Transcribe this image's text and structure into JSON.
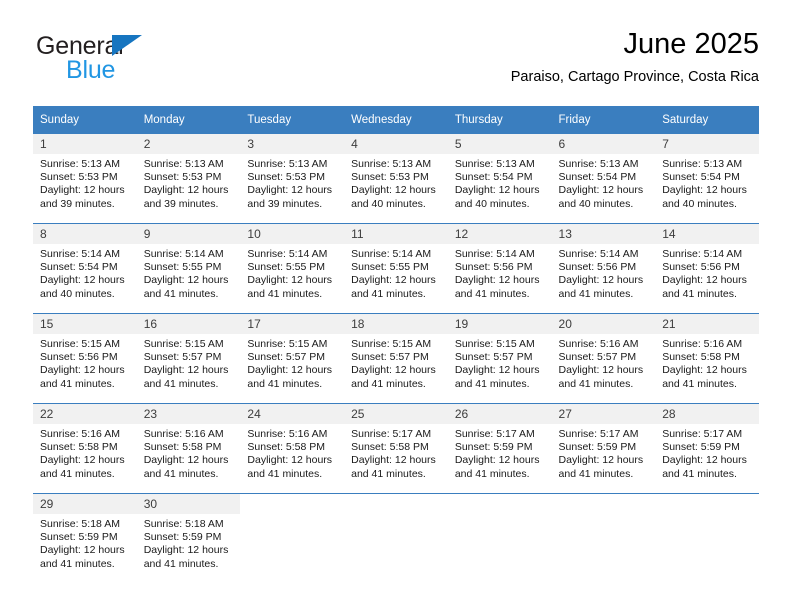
{
  "logo": {
    "primary_text": "General",
    "secondary_text": "Blue",
    "primary_color": "#231f20",
    "secondary_color": "#2196e3",
    "triangle_color": "#1675c0"
  },
  "header": {
    "title": "June 2025",
    "subtitle": "Paraiso, Cartago Province, Costa Rica"
  },
  "theme": {
    "header_bg": "#3a7ebf",
    "header_text": "#ffffff",
    "daynum_bg": "#f1f1f1",
    "cell_bg": "#ffffff",
    "divider": "#3a7ebf"
  },
  "calendar": {
    "weekday_headers": [
      "Sunday",
      "Monday",
      "Tuesday",
      "Wednesday",
      "Thursday",
      "Friday",
      "Saturday"
    ],
    "weeks": [
      [
        {
          "day": "1",
          "sunrise": "Sunrise: 5:13 AM",
          "sunset": "Sunset: 5:53 PM",
          "daylight_1": "Daylight: 12 hours",
          "daylight_2": "and 39 minutes."
        },
        {
          "day": "2",
          "sunrise": "Sunrise: 5:13 AM",
          "sunset": "Sunset: 5:53 PM",
          "daylight_1": "Daylight: 12 hours",
          "daylight_2": "and 39 minutes."
        },
        {
          "day": "3",
          "sunrise": "Sunrise: 5:13 AM",
          "sunset": "Sunset: 5:53 PM",
          "daylight_1": "Daylight: 12 hours",
          "daylight_2": "and 39 minutes."
        },
        {
          "day": "4",
          "sunrise": "Sunrise: 5:13 AM",
          "sunset": "Sunset: 5:53 PM",
          "daylight_1": "Daylight: 12 hours",
          "daylight_2": "and 40 minutes."
        },
        {
          "day": "5",
          "sunrise": "Sunrise: 5:13 AM",
          "sunset": "Sunset: 5:54 PM",
          "daylight_1": "Daylight: 12 hours",
          "daylight_2": "and 40 minutes."
        },
        {
          "day": "6",
          "sunrise": "Sunrise: 5:13 AM",
          "sunset": "Sunset: 5:54 PM",
          "daylight_1": "Daylight: 12 hours",
          "daylight_2": "and 40 minutes."
        },
        {
          "day": "7",
          "sunrise": "Sunrise: 5:13 AM",
          "sunset": "Sunset: 5:54 PM",
          "daylight_1": "Daylight: 12 hours",
          "daylight_2": "and 40 minutes."
        }
      ],
      [
        {
          "day": "8",
          "sunrise": "Sunrise: 5:14 AM",
          "sunset": "Sunset: 5:54 PM",
          "daylight_1": "Daylight: 12 hours",
          "daylight_2": "and 40 minutes."
        },
        {
          "day": "9",
          "sunrise": "Sunrise: 5:14 AM",
          "sunset": "Sunset: 5:55 PM",
          "daylight_1": "Daylight: 12 hours",
          "daylight_2": "and 41 minutes."
        },
        {
          "day": "10",
          "sunrise": "Sunrise: 5:14 AM",
          "sunset": "Sunset: 5:55 PM",
          "daylight_1": "Daylight: 12 hours",
          "daylight_2": "and 41 minutes."
        },
        {
          "day": "11",
          "sunrise": "Sunrise: 5:14 AM",
          "sunset": "Sunset: 5:55 PM",
          "daylight_1": "Daylight: 12 hours",
          "daylight_2": "and 41 minutes."
        },
        {
          "day": "12",
          "sunrise": "Sunrise: 5:14 AM",
          "sunset": "Sunset: 5:56 PM",
          "daylight_1": "Daylight: 12 hours",
          "daylight_2": "and 41 minutes."
        },
        {
          "day": "13",
          "sunrise": "Sunrise: 5:14 AM",
          "sunset": "Sunset: 5:56 PM",
          "daylight_1": "Daylight: 12 hours",
          "daylight_2": "and 41 minutes."
        },
        {
          "day": "14",
          "sunrise": "Sunrise: 5:14 AM",
          "sunset": "Sunset: 5:56 PM",
          "daylight_1": "Daylight: 12 hours",
          "daylight_2": "and 41 minutes."
        }
      ],
      [
        {
          "day": "15",
          "sunrise": "Sunrise: 5:15 AM",
          "sunset": "Sunset: 5:56 PM",
          "daylight_1": "Daylight: 12 hours",
          "daylight_2": "and 41 minutes."
        },
        {
          "day": "16",
          "sunrise": "Sunrise: 5:15 AM",
          "sunset": "Sunset: 5:57 PM",
          "daylight_1": "Daylight: 12 hours",
          "daylight_2": "and 41 minutes."
        },
        {
          "day": "17",
          "sunrise": "Sunrise: 5:15 AM",
          "sunset": "Sunset: 5:57 PM",
          "daylight_1": "Daylight: 12 hours",
          "daylight_2": "and 41 minutes."
        },
        {
          "day": "18",
          "sunrise": "Sunrise: 5:15 AM",
          "sunset": "Sunset: 5:57 PM",
          "daylight_1": "Daylight: 12 hours",
          "daylight_2": "and 41 minutes."
        },
        {
          "day": "19",
          "sunrise": "Sunrise: 5:15 AM",
          "sunset": "Sunset: 5:57 PM",
          "daylight_1": "Daylight: 12 hours",
          "daylight_2": "and 41 minutes."
        },
        {
          "day": "20",
          "sunrise": "Sunrise: 5:16 AM",
          "sunset": "Sunset: 5:57 PM",
          "daylight_1": "Daylight: 12 hours",
          "daylight_2": "and 41 minutes."
        },
        {
          "day": "21",
          "sunrise": "Sunrise: 5:16 AM",
          "sunset": "Sunset: 5:58 PM",
          "daylight_1": "Daylight: 12 hours",
          "daylight_2": "and 41 minutes."
        }
      ],
      [
        {
          "day": "22",
          "sunrise": "Sunrise: 5:16 AM",
          "sunset": "Sunset: 5:58 PM",
          "daylight_1": "Daylight: 12 hours",
          "daylight_2": "and 41 minutes."
        },
        {
          "day": "23",
          "sunrise": "Sunrise: 5:16 AM",
          "sunset": "Sunset: 5:58 PM",
          "daylight_1": "Daylight: 12 hours",
          "daylight_2": "and 41 minutes."
        },
        {
          "day": "24",
          "sunrise": "Sunrise: 5:16 AM",
          "sunset": "Sunset: 5:58 PM",
          "daylight_1": "Daylight: 12 hours",
          "daylight_2": "and 41 minutes."
        },
        {
          "day": "25",
          "sunrise": "Sunrise: 5:17 AM",
          "sunset": "Sunset: 5:58 PM",
          "daylight_1": "Daylight: 12 hours",
          "daylight_2": "and 41 minutes."
        },
        {
          "day": "26",
          "sunrise": "Sunrise: 5:17 AM",
          "sunset": "Sunset: 5:59 PM",
          "daylight_1": "Daylight: 12 hours",
          "daylight_2": "and 41 minutes."
        },
        {
          "day": "27",
          "sunrise": "Sunrise: 5:17 AM",
          "sunset": "Sunset: 5:59 PM",
          "daylight_1": "Daylight: 12 hours",
          "daylight_2": "and 41 minutes."
        },
        {
          "day": "28",
          "sunrise": "Sunrise: 5:17 AM",
          "sunset": "Sunset: 5:59 PM",
          "daylight_1": "Daylight: 12 hours",
          "daylight_2": "and 41 minutes."
        }
      ],
      [
        {
          "day": "29",
          "sunrise": "Sunrise: 5:18 AM",
          "sunset": "Sunset: 5:59 PM",
          "daylight_1": "Daylight: 12 hours",
          "daylight_2": "and 41 minutes."
        },
        {
          "day": "30",
          "sunrise": "Sunrise: 5:18 AM",
          "sunset": "Sunset: 5:59 PM",
          "daylight_1": "Daylight: 12 hours",
          "daylight_2": "and 41 minutes."
        },
        {
          "day": "",
          "sunrise": "",
          "sunset": "",
          "daylight_1": "",
          "daylight_2": ""
        },
        {
          "day": "",
          "sunrise": "",
          "sunset": "",
          "daylight_1": "",
          "daylight_2": ""
        },
        {
          "day": "",
          "sunrise": "",
          "sunset": "",
          "daylight_1": "",
          "daylight_2": ""
        },
        {
          "day": "",
          "sunrise": "",
          "sunset": "",
          "daylight_1": "",
          "daylight_2": ""
        },
        {
          "day": "",
          "sunrise": "",
          "sunset": "",
          "daylight_1": "",
          "daylight_2": ""
        }
      ]
    ]
  }
}
